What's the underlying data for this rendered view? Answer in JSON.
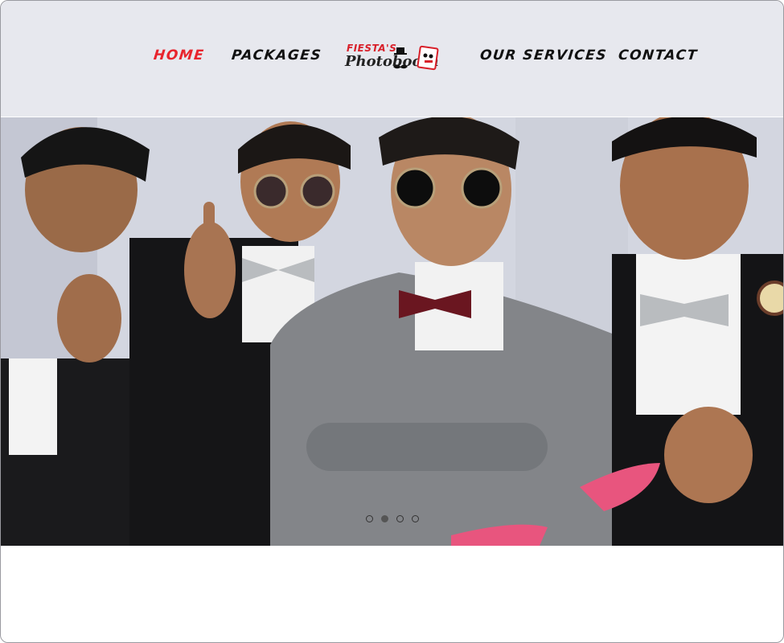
{
  "nav": {
    "items": [
      {
        "label": "HOME",
        "active": true
      },
      {
        "label": "PACKAGES",
        "active": false
      },
      {
        "label": "OUR SERVICES",
        "active": false
      },
      {
        "label": "CONTACT",
        "active": false
      }
    ]
  },
  "logo": {
    "top_text": "FIESTA'S",
    "main_text": "Photobooth"
  },
  "hero": {
    "image_icon": "photobooth-group-photo",
    "slides": 4,
    "active_slide": 2
  },
  "colors": {
    "header_bg": "#e7e8ee",
    "active_nav": "#e8242d",
    "nav_text": "#111111"
  }
}
